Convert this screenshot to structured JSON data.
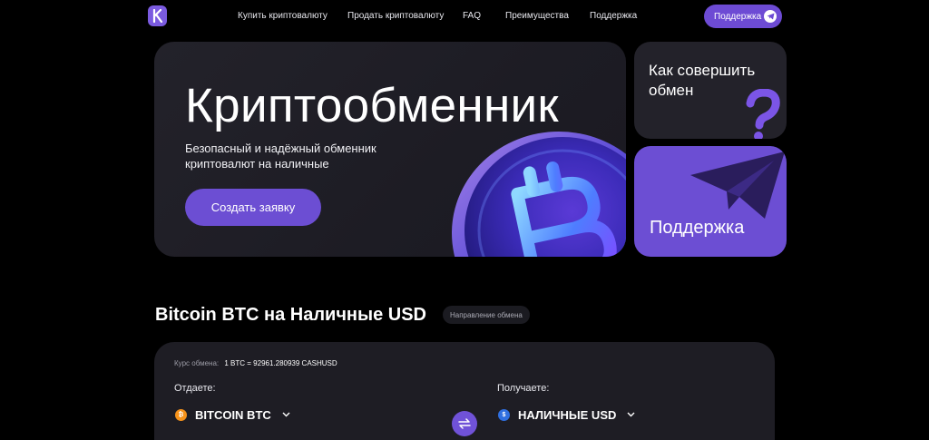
{
  "header": {
    "logo_letter": "K",
    "nav": [
      {
        "label": "Купить криптовалюту"
      },
      {
        "label": "Продать криптовалюту"
      },
      {
        "label": "FAQ"
      },
      {
        "label": "Преимущества"
      },
      {
        "label": "Поддержка"
      }
    ],
    "support_button": "Поддержка"
  },
  "hero": {
    "title": "Криптообменник",
    "subtitle": "Безопасный и надёжный обменник криптовалют на наличные",
    "cta": "Создать заявку"
  },
  "cards": {
    "how_to": "Как совершить обмен",
    "support": "Поддержка"
  },
  "exchange": {
    "title": "Bitcoin BTC на Наличные USD",
    "badge": "Направление обмена",
    "rate_label": "Курс обмена:",
    "rate_value": "1 BTC = 92961.280939 CASHUSD",
    "give_label": "Отдаете:",
    "give_currency": "BITCOIN BTC",
    "give_symbol": "₿",
    "receive_label": "Получаете:",
    "receive_currency": "НАЛИЧНЫЕ USD",
    "receive_symbol": "$"
  },
  "colors": {
    "accent": "#6c4ed3",
    "card": "#23222a",
    "btc": "#f7931a",
    "usd": "#2f6fe0"
  }
}
